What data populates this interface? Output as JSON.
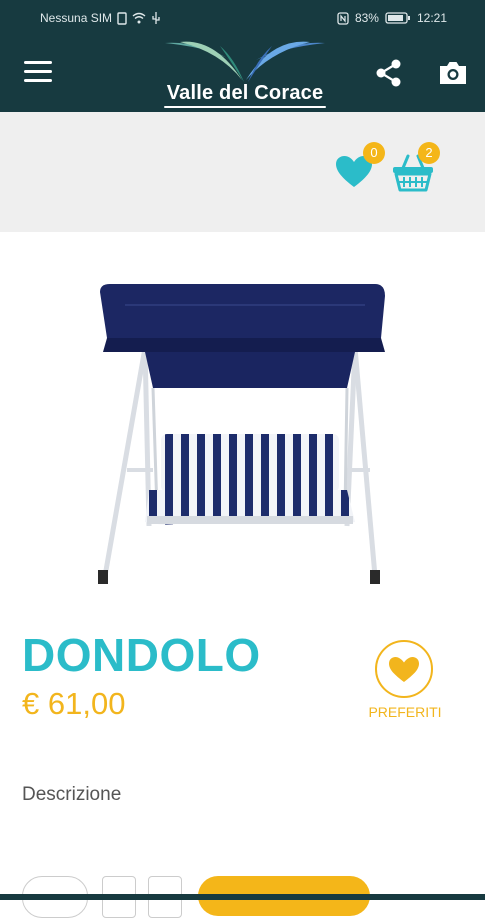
{
  "status_bar": {
    "carrier": "Nessuna SIM",
    "battery": "83%",
    "time": "12:21"
  },
  "app_bar": {
    "logo_text": "Valle del Corace",
    "colors": {
      "background": "#173a40",
      "accent": "#2bbcc9",
      "secondary": "#f2b51d"
    }
  },
  "header_actions": {
    "wishlist_count": "0",
    "cart_count": "2"
  },
  "product": {
    "name": "DONDOLO",
    "price": "€ 61,00",
    "favorite_label": "PREFERITI",
    "description_label": "Descrizione"
  },
  "icons": [
    "menu-icon",
    "share-icon",
    "camera-icon",
    "heart-icon",
    "basket-icon"
  ]
}
